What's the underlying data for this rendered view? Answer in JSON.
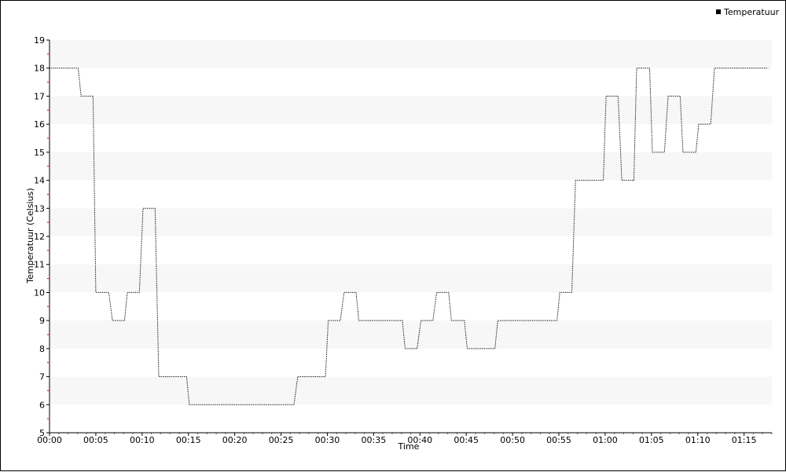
{
  "chart_data": {
    "type": "line",
    "title": "",
    "xlabel": "Time",
    "ylabel": "Temperatuur (Celsius)",
    "xlim": [
      0,
      78
    ],
    "ylim": [
      5,
      19
    ],
    "x_ticks": [
      {
        "label": "00:00",
        "value": 0
      },
      {
        "label": "00:05",
        "value": 5
      },
      {
        "label": "00:10",
        "value": 10
      },
      {
        "label": "00:15",
        "value": 15
      },
      {
        "label": "00:20",
        "value": 20
      },
      {
        "label": "00:25",
        "value": 25
      },
      {
        "label": "00:30",
        "value": 30
      },
      {
        "label": "00:35",
        "value": 35
      },
      {
        "label": "00:40",
        "value": 40
      },
      {
        "label": "00:45",
        "value": 45
      },
      {
        "label": "00:50",
        "value": 50
      },
      {
        "label": "00:55",
        "value": 55
      },
      {
        "label": "01:00",
        "value": 60
      },
      {
        "label": "01:05",
        "value": 65
      },
      {
        "label": "01:10",
        "value": 70
      },
      {
        "label": "01:15",
        "value": 75
      }
    ],
    "y_ticks": [
      "5",
      "6",
      "7",
      "8",
      "9",
      "10",
      "11",
      "12",
      "13",
      "14",
      "15",
      "16",
      "17",
      "18",
      "19"
    ],
    "grid": "alternating horizontal bands",
    "legend_position": "top-right",
    "series": [
      {
        "name": "Temperatuur",
        "color": "#000000",
        "style": "dotted",
        "points": [
          [
            0,
            18
          ],
          [
            3.1,
            18
          ],
          [
            3.4,
            17
          ],
          [
            4.7,
            17
          ],
          [
            5.0,
            10
          ],
          [
            6.4,
            10
          ],
          [
            6.8,
            9
          ],
          [
            8.1,
            9
          ],
          [
            8.4,
            10
          ],
          [
            9.7,
            10
          ],
          [
            10.1,
            13
          ],
          [
            11.4,
            13
          ],
          [
            11.8,
            7
          ],
          [
            14.8,
            7
          ],
          [
            15.1,
            6
          ],
          [
            26.4,
            6
          ],
          [
            26.8,
            7
          ],
          [
            29.8,
            7
          ],
          [
            30.1,
            9
          ],
          [
            31.4,
            9
          ],
          [
            31.8,
            10
          ],
          [
            33.1,
            10
          ],
          [
            33.4,
            9
          ],
          [
            38.1,
            9
          ],
          [
            38.4,
            8
          ],
          [
            39.7,
            8
          ],
          [
            40.1,
            9
          ],
          [
            41.4,
            9
          ],
          [
            41.8,
            10
          ],
          [
            43.1,
            10
          ],
          [
            43.4,
            9
          ],
          [
            44.8,
            9
          ],
          [
            45.1,
            8
          ],
          [
            48.1,
            8
          ],
          [
            48.4,
            9
          ],
          [
            54.8,
            9
          ],
          [
            55.1,
            10
          ],
          [
            56.4,
            10
          ],
          [
            56.8,
            14
          ],
          [
            59.8,
            14
          ],
          [
            60.1,
            17
          ],
          [
            61.4,
            17
          ],
          [
            61.8,
            14
          ],
          [
            63.1,
            14
          ],
          [
            63.4,
            18
          ],
          [
            64.8,
            18
          ],
          [
            65.1,
            15
          ],
          [
            66.4,
            15
          ],
          [
            66.8,
            17
          ],
          [
            68.1,
            17
          ],
          [
            68.4,
            15
          ],
          [
            69.8,
            15
          ],
          [
            70.1,
            16
          ],
          [
            71.4,
            16
          ],
          [
            71.8,
            18
          ],
          [
            77.6,
            18
          ]
        ]
      }
    ]
  }
}
